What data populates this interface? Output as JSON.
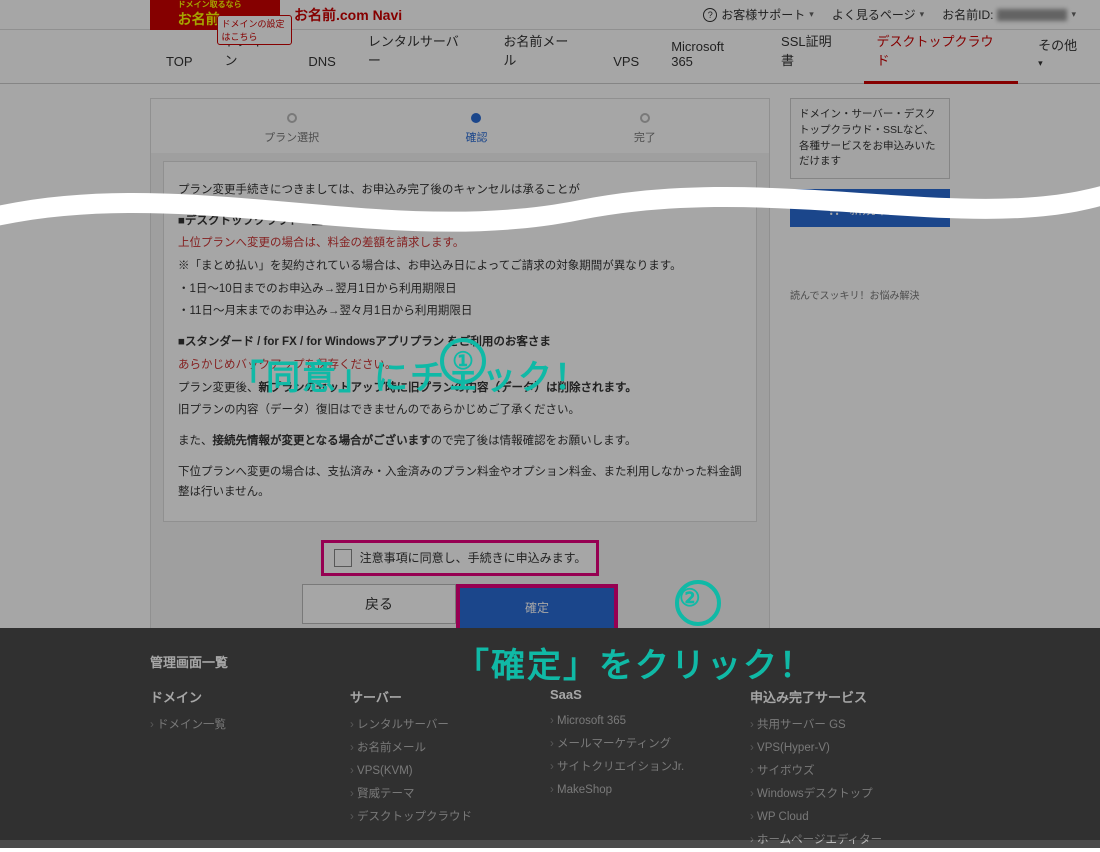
{
  "header": {
    "logo_main": "お名前.com",
    "logo_tag": "ドメイン取るなら",
    "brand": "お名前.com Navi",
    "support": "お客様サポート",
    "freq_pages": "よく見るページ",
    "account_label": "お名前ID:"
  },
  "nav": {
    "items": [
      {
        "label": "TOP"
      },
      {
        "label": "ドメイン",
        "badge": "ドメインの設定はこちら"
      },
      {
        "label": "DNS"
      },
      {
        "label": "レンタルサーバー"
      },
      {
        "label": "お名前メール"
      },
      {
        "label": "VPS"
      },
      {
        "label": "Microsoft 365"
      },
      {
        "label": "SSL証明書"
      },
      {
        "label": "デスクトップクラウド",
        "active": true
      },
      {
        "label": "その他"
      }
    ]
  },
  "steps": {
    "s1": "プラン選択",
    "s2": "確認",
    "s3": "完了"
  },
  "notice": {
    "lead": "プラン変更手続きにつきましては、お申込み完了後のキャンセルは承ることが",
    "h1": "■デスクトップクラウド　全プラン共通",
    "r1": "上位プランへ変更の場合は、料金の差額を請求します。",
    "p1": "※「まとめ払い」を契約されている場合は、お申込み日によってご請求の対象期間が異なります。",
    "p2": "・1日～10日までのお申込み→翌月1日から利用期限日",
    "p3": "・11日～月末までのお申込み→翌々月1日から利用期限日",
    "h2": "■スタンダード / for FX / for Windowsアプリプラン をご利用のお客さま",
    "r2": "あらかじめバックアップを保存ください。",
    "p4a": "プラン変更後、",
    "p4b": "新プランのセットアップ時に旧プランの内容（データ）は削除されます。",
    "p5": "旧プランの内容（データ）復旧はできませんのであらかじめご了承ください。",
    "p6a": "また、",
    "p6b": "接続先情報が変更となる場合がございます",
    "p6c": "ので完了後は情報確認をお願いします。",
    "p7": "下位プランへ変更の場合は、支払済み・入金済みのプラン料金やオプション料金、また利用しなかった料金調整は行いません。"
  },
  "consent": {
    "label": "注意事項に同意し、手続きに申込みます。"
  },
  "buttons": {
    "back": "戻る",
    "confirm": "確定"
  },
  "sidebar": {
    "promo": "ドメイン・サーバー・デスクトップクラウド・SSLなど、各種サービスをお申込みいただけます",
    "cta": "新規申込み",
    "note": "読んでスッキリ！お悩み解決"
  },
  "callouts": {
    "c1_num": "①",
    "c1_txt": "「同意」にチェック！",
    "c2_num": "②",
    "c2_txt": "「確定」をクリック！"
  },
  "footer": {
    "title": "管理画面一覧",
    "cols": [
      {
        "head": "ドメイン",
        "items": [
          "ドメイン一覧"
        ]
      },
      {
        "head": "サーバー",
        "items": [
          "レンタルサーバー",
          "お名前メール",
          "VPS(KVM)",
          "賢威テーマ",
          "デスクトップクラウド"
        ]
      },
      {
        "head": "SaaS",
        "items": [
          "Microsoft 365",
          "メールマーケティング",
          "サイトクリエイションJr.",
          "MakeShop"
        ]
      },
      {
        "head": "申込み完了サービス",
        "items": [
          "共用サーバー GS",
          "VPS(Hyper-V)",
          "サイボウズ",
          "Windowsデスクトップ",
          "WP Cloud",
          "ホームページエディター"
        ]
      }
    ]
  }
}
